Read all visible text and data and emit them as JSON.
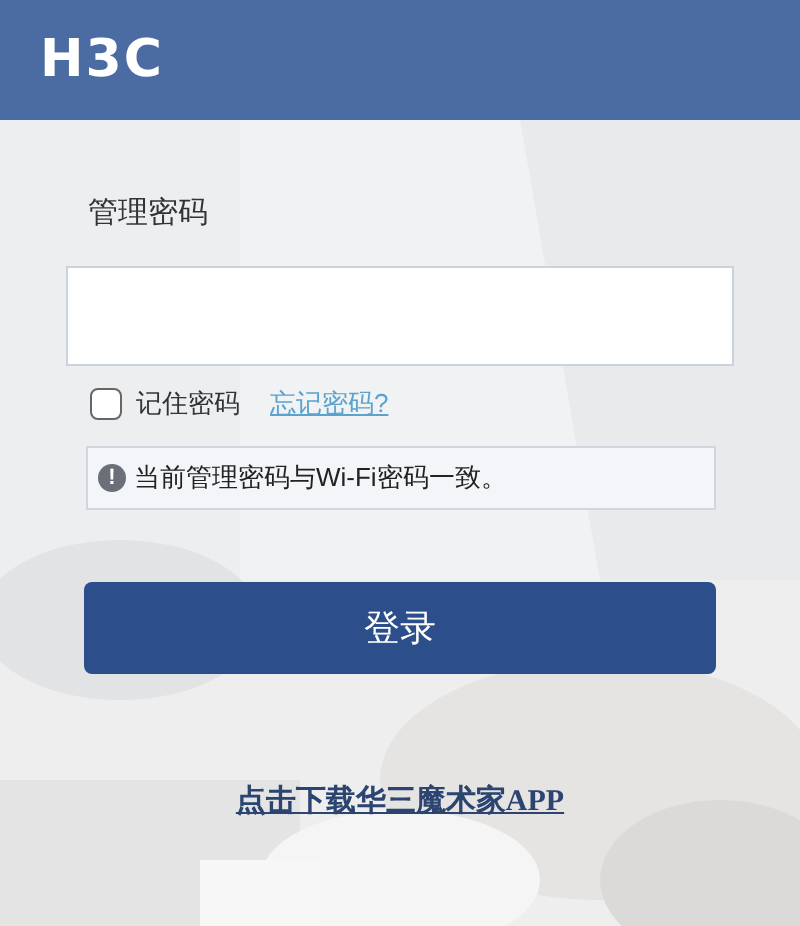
{
  "header": {
    "logo": "H3C"
  },
  "login": {
    "password_label": "管理密码",
    "remember": {
      "label": "记住密码",
      "checked": false
    },
    "forgot_link": "忘记密码?",
    "notice": {
      "icon": "!",
      "text": "当前管理密码与Wi-Fi密码一致。"
    },
    "login_button": "登录"
  },
  "download_link": "点击下载华三魔术家APP"
}
